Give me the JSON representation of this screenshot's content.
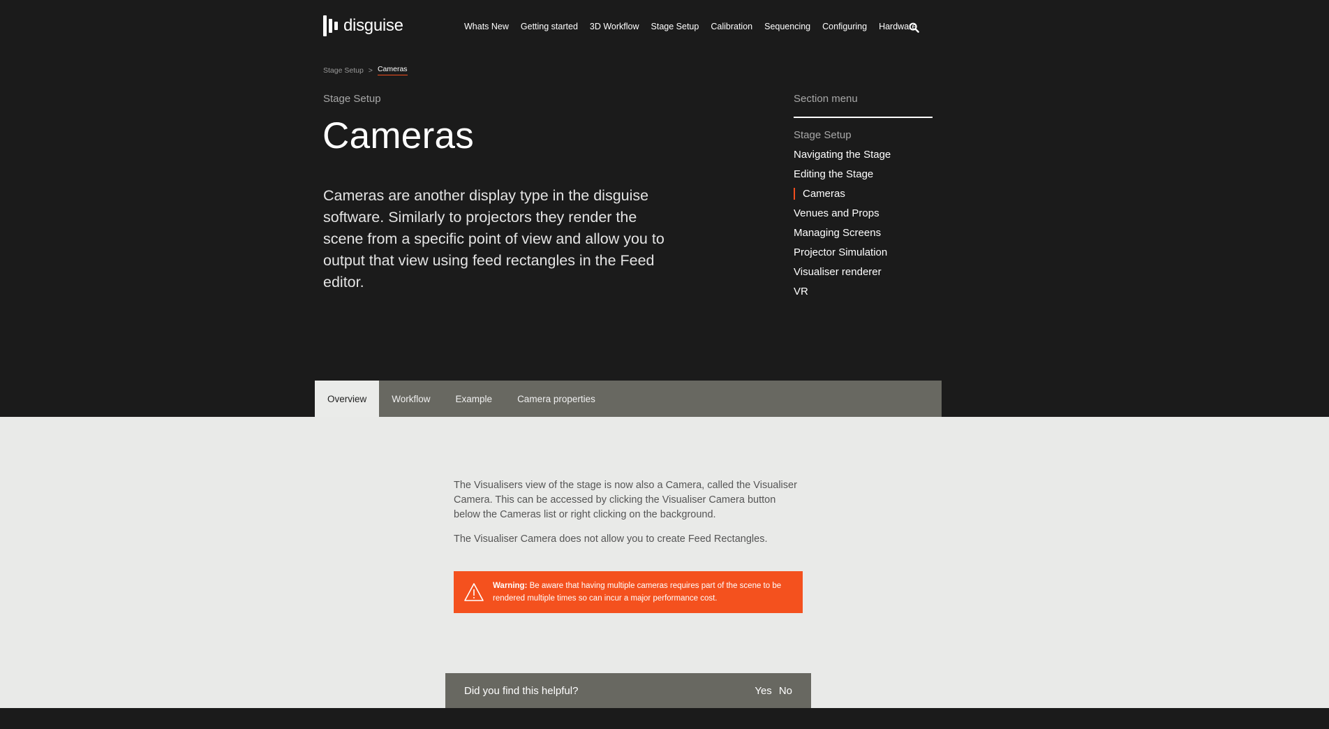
{
  "brand": {
    "name": "disguise"
  },
  "nav": {
    "items": [
      "Whats New",
      "Getting started",
      "3D Workflow",
      "Stage Setup",
      "Calibration",
      "Sequencing",
      "Configuring",
      "Hardware"
    ],
    "search_icon": "search-icon"
  },
  "breadcrumb": {
    "parent": "Stage Setup",
    "separator": ">",
    "current": "Cameras"
  },
  "hero": {
    "eyebrow": "Stage Setup",
    "title": "Cameras",
    "intro": "Cameras are another display type in the disguise software. Similarly to projectors they render the scene from a specific point of view and allow you to output that view using feed rectangles in the Feed editor."
  },
  "section_menu": {
    "title": "Section menu",
    "heading": "Stage Setup",
    "items": [
      "Navigating the Stage",
      "Editing the Stage",
      "Cameras",
      "Venues and Props",
      "Managing Screens",
      "Projector Simulation",
      "Visualiser renderer",
      "VR"
    ],
    "active_index": 2
  },
  "tabs": [
    "Overview",
    "Workflow",
    "Example",
    "Camera properties"
  ],
  "content": {
    "paragraphs": [
      "The Visualisers view of the stage is now also a Camera, called the Visualiser Camera. This can be accessed by clicking the Visualiser Camera button below the Cameras list or right clicking on the background.",
      "The Visualiser Camera does not allow you to create Feed Rectangles."
    ],
    "warning": {
      "label": "Warning:",
      "text": " Be aware that having multiple cameras requires part of the scene to be rendered multiple times so can incur a major performance cost.",
      "icon": "warning-triangle-icon"
    }
  },
  "feedback": {
    "question": "Did you find this helpful?",
    "yes": "Yes",
    "no": "No"
  },
  "colors": {
    "accent": "#f24e1e",
    "warning_bg": "#f4511e",
    "tab_bar": "#686861",
    "dark_bg": "#1b1b1b",
    "light_bg": "#e9eae8"
  }
}
